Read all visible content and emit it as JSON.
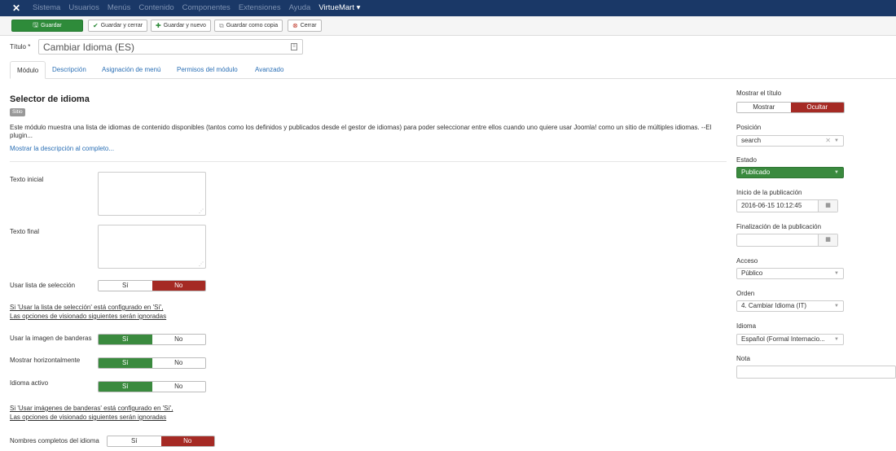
{
  "navbar": {
    "logo": "joomla-logo",
    "items": [
      "Sistema",
      "Usuarios",
      "Menús",
      "Contenido",
      "Componentes",
      "Extensiones",
      "Ayuda",
      "VirtueMart ▾"
    ]
  },
  "toolbar": {
    "save": "Guardar",
    "save_close": "Guardar y cerrar",
    "save_new": "Guardar y nuevo",
    "save_copy": "Guardar como copia",
    "close": "Cerrar"
  },
  "title": {
    "label": "Título *",
    "value": "Cambiar Idioma (ES)"
  },
  "tabs": [
    "Módulo",
    "Descripción",
    "Asignación de menú",
    "Permisos del módulo",
    "Avanzado"
  ],
  "module": {
    "heading": "Selector de idioma",
    "badge": "Sitio",
    "description": "Este módulo muestra una lista de idiomas de contenido disponibles (tantos como los definidos y publicados desde el gestor de idiomas) para poder seleccionar entre ellos cuando uno quiere usar Joomla! como un sitio de múltiples idiomas. --El plugin...",
    "show_more": "Mostrar la descripción al completo..."
  },
  "fields": {
    "pretext_label": "Texto inicial",
    "posttext_label": "Texto final",
    "dropdown_label": "Usar lista de selección",
    "yes": "Sí",
    "no": "No",
    "note1_line1": "Si 'Usar la lista de selección' está configurado en 'Sí',",
    "note1_line2": "Las opciones de visionado siguientes serán ignoradas",
    "flags_label": "Usar la imagen de banderas",
    "horizontal_label": "Mostrar horizontalmente",
    "active_label": "Idioma activo",
    "note2_line1": "Si 'Usar imágenes de banderas' está configurado en 'Sí',",
    "note2_line2": "Las opciones de visionado siguientes serán ignoradas",
    "fullnames_label": "Nombres completos del idioma"
  },
  "sidebar": {
    "show_title_label": "Mostrar el título",
    "show": "Mostrar",
    "hide": "Ocultar",
    "position_label": "Posición",
    "position_value": "search",
    "status_label": "Estado",
    "status_value": "Publicado",
    "publish_up_label": "Inicio de la publicación",
    "publish_up_value": "2016-06-15 10:12:45",
    "publish_down_label": "Finalización de la publicación",
    "publish_down_value": "",
    "access_label": "Acceso",
    "access_value": "Público",
    "order_label": "Orden",
    "order_value": "4. Cambiar Idioma (IT)",
    "language_label": "Idioma",
    "language_value": "Español (Formal Internacio...",
    "note_label": "Nota",
    "note_value": ""
  }
}
